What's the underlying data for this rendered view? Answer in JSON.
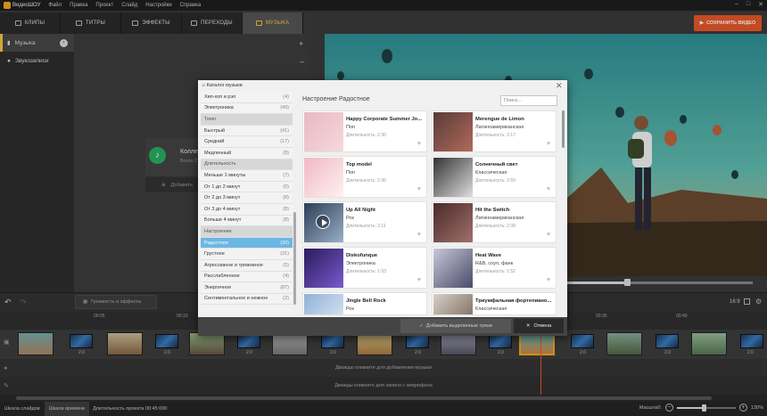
{
  "menubar": {
    "app": "ВидеоШОУ",
    "items": [
      "Файл",
      "Правка",
      "Проект",
      "Слайд",
      "Настройки",
      "Справка"
    ]
  },
  "tabs": [
    {
      "label": "КЛИПЫ",
      "icon": "film-icon"
    },
    {
      "label": "ТИТРЫ",
      "icon": "text-icon"
    },
    {
      "label": "ЭФФЕКТЫ",
      "icon": "effects-icon"
    },
    {
      "label": "ПЕРЕХОДЫ",
      "icon": "transition-icon"
    },
    {
      "label": "МУЗЫКА",
      "icon": "music-icon",
      "active": true
    }
  ],
  "save_button": "СОХРАНИТЬ ВИДЕО",
  "sidebar": {
    "items": [
      {
        "label": "Музыка",
        "active": true
      },
      {
        "label": "Звукозаписи",
        "active": false
      }
    ]
  },
  "collection": {
    "title": "Колле",
    "subtitle": "Всего 2",
    "add_text": "Добавить"
  },
  "toolbar": {
    "fx_label": "Громкость и эффекты",
    "ratio": "16:9"
  },
  "timeline": {
    "ticks": [
      "00:05",
      "00:10",
      "00:35",
      "00:40"
    ],
    "transition_values": [
      "2.0",
      "2.0",
      "2.0",
      "2.0",
      "2.0",
      "2.0",
      "2.0",
      "2.0",
      "2.0",
      "2.0",
      "2.0",
      "2.0",
      "2.0",
      "2.0",
      "2.0",
      "2.0"
    ],
    "music_hint": "Дважды кликните для добавления музыки",
    "voice_hint": "Дважды кликните для записи с микрофона"
  },
  "status": {
    "tab_slides": "Шкала слайдов",
    "tab_time": "Шкала времени",
    "duration": "Длительность проекта 00:45:000",
    "zoom_label": "Масштаб:",
    "zoom_value": "130%",
    "zoom_level": 0.45
  },
  "modal": {
    "title": "Каталог музыки",
    "breadcrumb": "Настроение   Радостное",
    "search_placeholder": "Поиск...",
    "categories": [
      {
        "label": "Хип-хоп и рэп",
        "count": "(4)",
        "type": "item"
      },
      {
        "label": "Электроника",
        "count": "(49)",
        "type": "item"
      },
      {
        "label": "Темп",
        "count": "",
        "type": "head"
      },
      {
        "label": "Быстрый",
        "count": "(41)",
        "type": "item"
      },
      {
        "label": "Средний",
        "count": "(17)",
        "type": "item"
      },
      {
        "label": "Медленный",
        "count": "(8)",
        "type": "item"
      },
      {
        "label": "Длительность",
        "count": "",
        "type": "head"
      },
      {
        "label": "Меньше 1 минуты",
        "count": "(7)",
        "type": "item"
      },
      {
        "label": "От 1 до 2 минут",
        "count": "(6)",
        "type": "item"
      },
      {
        "label": "От 2 до 3 минут",
        "count": "(8)",
        "type": "item"
      },
      {
        "label": "От 3 до 4 минут",
        "count": "(8)",
        "type": "item"
      },
      {
        "label": "Больше 4 минут",
        "count": "(8)",
        "type": "item"
      },
      {
        "label": "Настроение",
        "count": "",
        "type": "head"
      },
      {
        "label": "Радостное",
        "count": "(30)",
        "type": "sel"
      },
      {
        "label": "Грустное",
        "count": "(31)",
        "type": "item"
      },
      {
        "label": "Агрессивное и тревожное",
        "count": "(5)",
        "type": "item"
      },
      {
        "label": "Расслабленное",
        "count": "(4)",
        "type": "item"
      },
      {
        "label": "Энергичное",
        "count": "(87)",
        "type": "item"
      },
      {
        "label": "Сентиментальное и нежное",
        "count": "(2)",
        "type": "item"
      }
    ],
    "tracks": [
      {
        "name": "Happy Corporate Summer Jo...",
        "genre": "Поп",
        "duration": "Длительность: 2:30"
      },
      {
        "name": "Merengue de Limon",
        "genre": "Латиноамериканская",
        "duration": "Длительность: 2:17"
      },
      {
        "name": "Top model",
        "genre": "Поп",
        "duration": "Длительность: 2:36"
      },
      {
        "name": "Солнечный свет",
        "genre": "Классическая",
        "duration": "Длительность: 2:59"
      },
      {
        "name": "Up All Night",
        "genre": "Рок",
        "duration": "Длительность: 2:11"
      },
      {
        "name": "Hit the Switch",
        "genre": "Латиноамериканская",
        "duration": "Длительность: 2:39"
      },
      {
        "name": "Diskofunque",
        "genre": "Электроника",
        "duration": "Длительность: 1:53"
      },
      {
        "name": "Heat Wave",
        "genre": "R&B, соул, фанк",
        "duration": "Длительность: 1:52"
      },
      {
        "name": "Jingle Bell Rock",
        "genre": "Рок",
        "duration": ""
      },
      {
        "name": "Триумфальная фортепиано...",
        "genre": "Классическая",
        "duration": ""
      }
    ],
    "add_selected": "Добавить выделенные треки",
    "cancel": "Отмена"
  }
}
